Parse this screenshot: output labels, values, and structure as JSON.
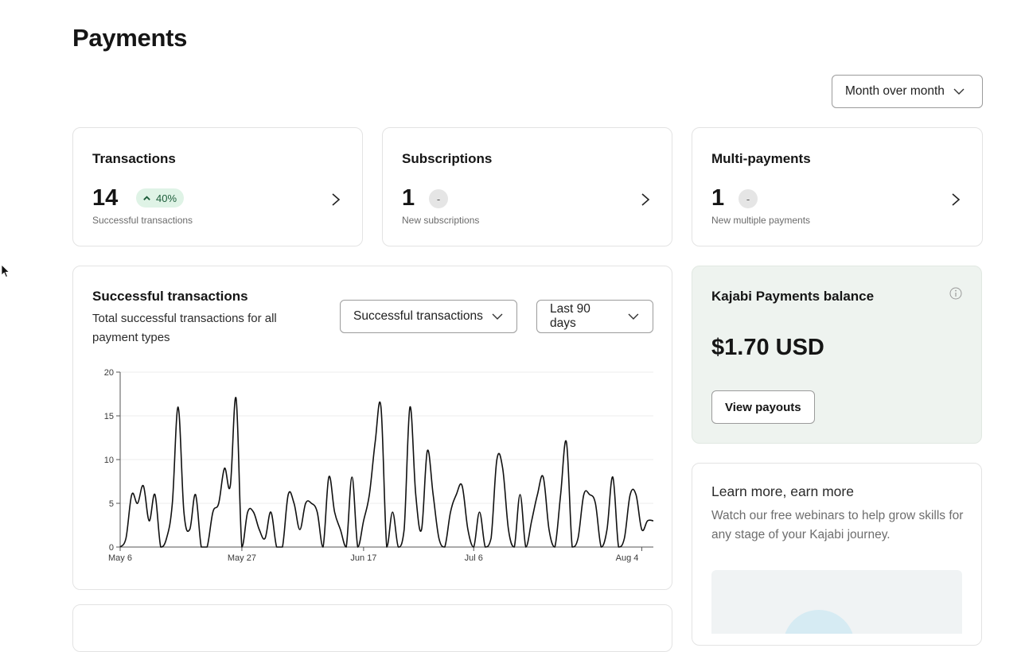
{
  "page": {
    "title": "Payments"
  },
  "comparison": {
    "label": "Month over month",
    "icon": "chevron-down-icon"
  },
  "stats": [
    {
      "title": "Transactions",
      "value": "14",
      "badge": "40%",
      "badge_icon": "chevron-up-icon",
      "desc": "Successful transactions"
    },
    {
      "title": "Subscriptions",
      "value": "1",
      "badge": "-",
      "desc": "New subscriptions"
    },
    {
      "title": "Multi-payments",
      "value": "1",
      "badge": "-",
      "desc": "New multiple payments"
    }
  ],
  "chart_panel": {
    "title": "Successful transactions",
    "subtitle": "Total successful transactions for all payment types",
    "metric_select": "Successful transactions",
    "range_select": "Last 90 days"
  },
  "balance": {
    "title": "Kajabi Payments balance",
    "amount": "$1.70 USD",
    "button": "View payouts",
    "bg_color": "#eef3ef"
  },
  "learn": {
    "title": "Learn more, earn more",
    "body": "Watch our free webinars to help grow skills for any stage of your Kajabi journey."
  },
  "colors": {
    "accent_green_bg": "#dff3e6",
    "accent_green_text": "#1c5d3a",
    "text": "#151515"
  },
  "chart_data": {
    "type": "line",
    "title": "",
    "xlabel": "",
    "ylabel": "",
    "ylim": [
      0,
      20
    ],
    "yticks": [
      0,
      5,
      10,
      15,
      20
    ],
    "xticks": [
      {
        "label": "May 6",
        "day": 0
      },
      {
        "label": "May 27",
        "day": 21
      },
      {
        "label": "Jun 17",
        "day": 42
      },
      {
        "label": "Jul 6",
        "day": 61
      },
      {
        "label": "Aug 4",
        "day": 90
      }
    ],
    "grid": true,
    "series": [
      {
        "values": [
          0,
          1,
          6,
          5,
          7,
          3,
          6,
          0,
          1,
          5,
          16,
          4,
          2,
          6,
          0,
          0,
          4,
          5,
          9,
          7,
          17,
          0,
          4,
          4,
          2,
          1,
          4,
          0,
          0,
          6,
          5,
          2,
          5,
          5,
          4,
          0,
          8,
          4,
          2,
          0,
          8,
          0,
          3,
          6,
          12,
          16,
          0,
          4,
          0,
          2,
          16,
          6,
          2,
          11,
          6,
          1,
          0,
          4,
          6,
          7,
          2,
          0,
          4,
          0,
          1,
          10,
          9,
          2,
          0,
          6,
          0,
          3,
          6,
          8,
          2,
          0,
          6,
          12,
          0,
          1,
          6,
          6,
          5,
          0,
          2,
          8,
          0,
          1,
          6,
          6,
          2,
          3,
          3
        ]
      }
    ]
  }
}
